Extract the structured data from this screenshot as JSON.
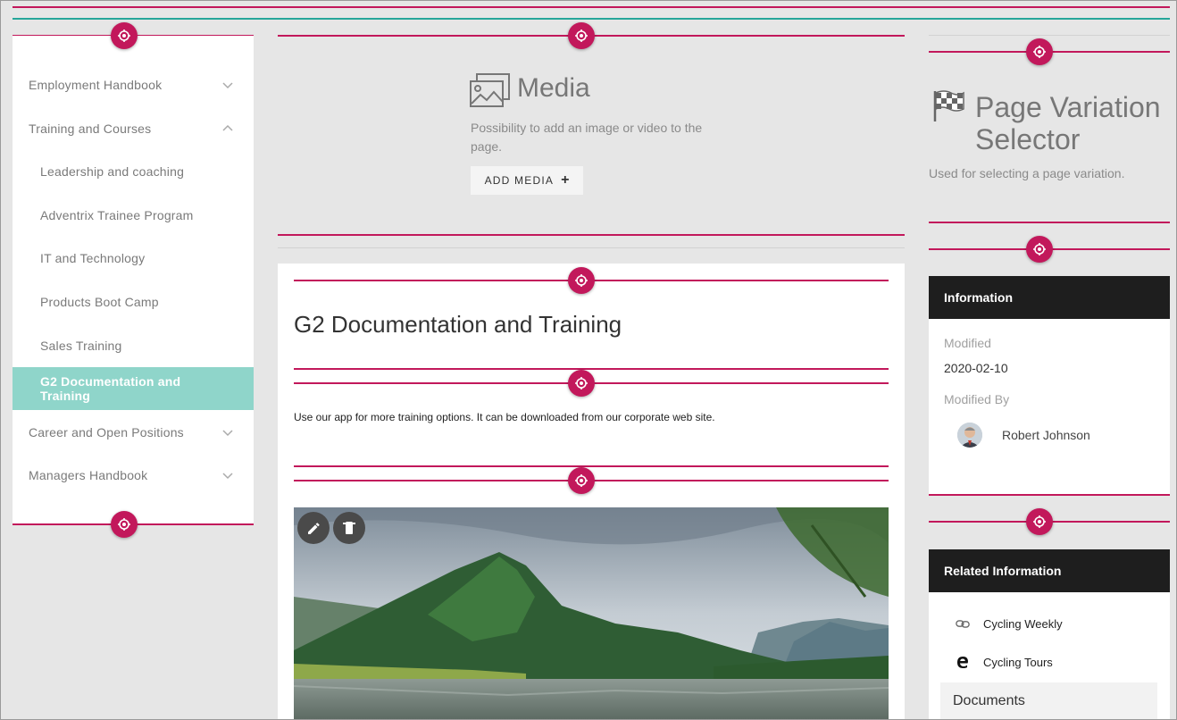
{
  "nav": {
    "items": [
      {
        "label": "Employment Handbook",
        "chevron": "chevron-down"
      },
      {
        "label": "Training and Courses",
        "chevron": "chevron-up"
      },
      {
        "label": "Leadership and coaching"
      },
      {
        "label": "Adventrix Trainee Program"
      },
      {
        "label": "IT and Technology"
      },
      {
        "label": "Products Boot Camp"
      },
      {
        "label": "Sales Training"
      },
      {
        "label": "G2 Documentation and Training",
        "active": true
      },
      {
        "label": "Career and Open Positions",
        "chevron": "chevron-down"
      },
      {
        "label": "Managers Handbook",
        "chevron": "chevron-down"
      }
    ]
  },
  "media": {
    "title": "Media",
    "description": "Possibility to add an image or video to the page.",
    "button_label": "ADD MEDIA",
    "button_icon": "+"
  },
  "content": {
    "title": "G2 Documentation and Training",
    "body": "Use our app for more training options. It can be downloaded from our corporate web site.",
    "image_actions": [
      "edit-icon",
      "delete-icon"
    ]
  },
  "page_variation": {
    "title": "Page Variation Selector",
    "description": "Used for selecting a page variation."
  },
  "information": {
    "header": "Information",
    "modified_label": "Modified",
    "modified_value": "2020-02-10",
    "modified_by_label": "Modified By",
    "author": "Robert Johnson"
  },
  "related": {
    "header": "Related Information",
    "links": [
      {
        "label": "Cycling Weekly",
        "icon": "link-icon"
      },
      {
        "label": "Cycling Tours",
        "icon": "edge-icon"
      }
    ],
    "documents_label": "Documents"
  },
  "colors": {
    "accent": "#c2185b",
    "teal_line": "#26a69a",
    "active_nav": "#8fd5ca",
    "dark_header": "#1e1e1e",
    "background": "#e6e6e6"
  }
}
